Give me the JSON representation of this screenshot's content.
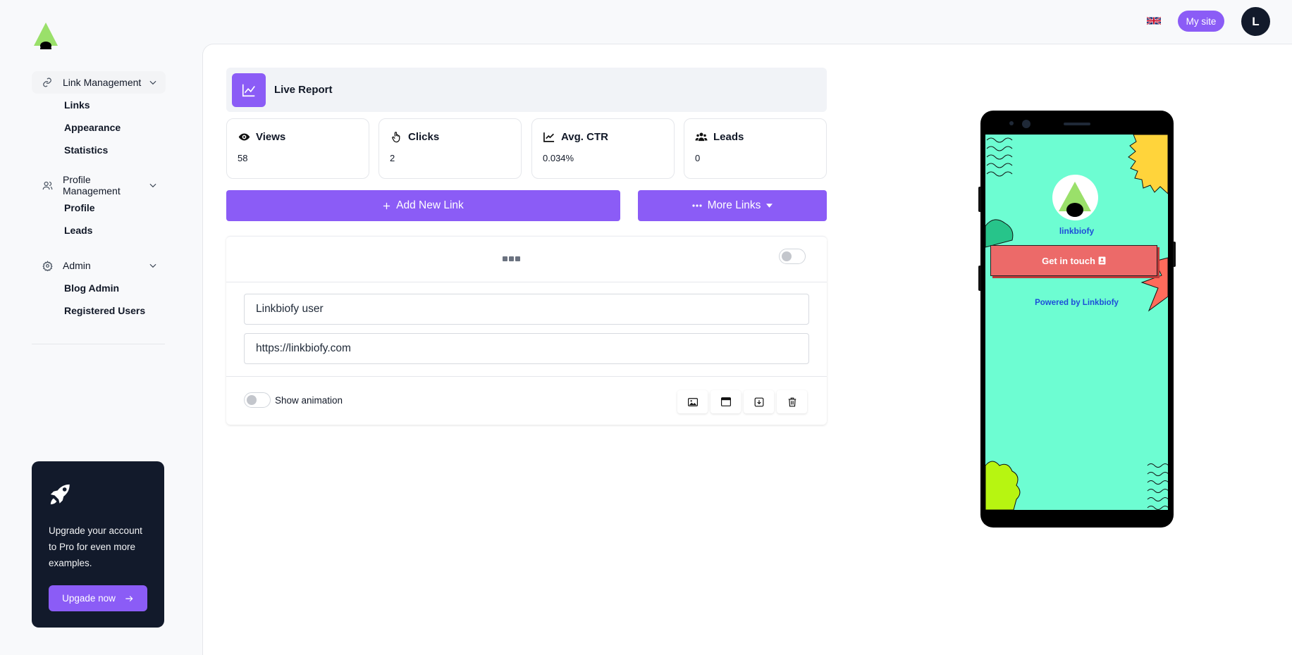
{
  "sidebar": {
    "groups": [
      {
        "label": "Link Management",
        "items": [
          "Links",
          "Appearance",
          "Statistics"
        ]
      },
      {
        "label": "Profile Management",
        "items": [
          "Profile",
          "Leads"
        ]
      },
      {
        "label": "Admin",
        "items": [
          "Blog Admin",
          "Registered Users"
        ]
      }
    ],
    "upgrade": {
      "message": "Upgrade your account to Pro for even more examples.",
      "button_label": "Upgade now"
    }
  },
  "topbar": {
    "language_icon": "uk-flag-icon",
    "mysite_label": "My site",
    "avatar_initial": "L"
  },
  "report": {
    "title": "Live Report"
  },
  "stats": [
    {
      "label": "Views",
      "value": "58",
      "icon": "eye-icon"
    },
    {
      "label": "Clicks",
      "value": "2",
      "icon": "pointer-hand-icon"
    },
    {
      "label": "Avg. CTR",
      "value": "0.034%",
      "icon": "chart-line-icon"
    },
    {
      "label": "Leads",
      "value": "0",
      "icon": "users-icon"
    }
  ],
  "actions": {
    "add_link_label": "Add New Link",
    "more_links_label": "More Links"
  },
  "link_card": {
    "title_value": "Linkbiofy user",
    "url_value": "https://linkbiofy.com",
    "animation_label": "Show animation",
    "tools": [
      "image-icon",
      "calendar-window-icon",
      "download-icon",
      "trash-icon"
    ]
  },
  "preview": {
    "name": "linkbiofy",
    "button_label": "Get in touch",
    "powered_by": "Powered by Linkbiofy"
  },
  "colors": {
    "accent": "#8b5cf6",
    "dark": "#121a2b",
    "preview_bg": "#6dfdd2",
    "preview_button": "#ec6a69"
  }
}
